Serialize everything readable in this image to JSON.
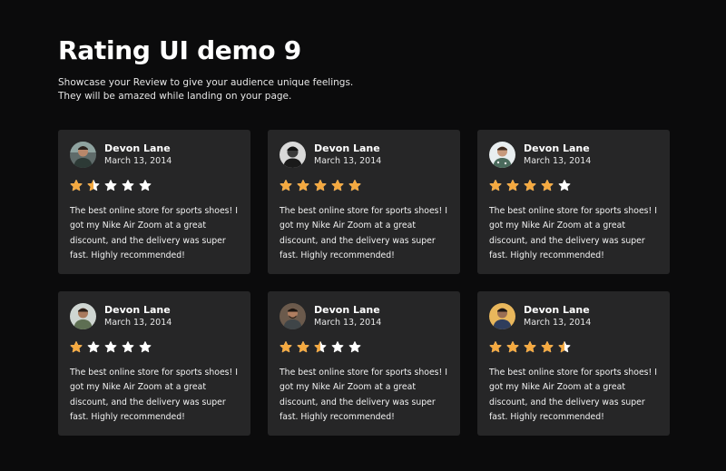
{
  "header": {
    "title": "Rating UI demo 9",
    "subtitle": "Showcase your Review to give your audience unique feelings. They will be amazed while landing on your page."
  },
  "colors": {
    "background": "#0b0b0c",
    "card": "#262627",
    "star_filled": "#f4a940",
    "star_empty": "#ffffff"
  },
  "reviews": [
    {
      "name": "Devon Lane",
      "date": "March 13, 2014",
      "rating": 1.5,
      "avatar": "avatar-photo",
      "text": "The best online store for sports shoes! I got my Nike Air Zoom at a great discount, and the delivery was super fast. Highly recommended!"
    },
    {
      "name": "Devon Lane",
      "date": "March 13, 2014",
      "rating": 5,
      "avatar": "avatar-photo",
      "text": "The best online store for sports shoes! I got my Nike Air Zoom at a great discount, and the delivery was super fast. Highly recommended!"
    },
    {
      "name": "Devon Lane",
      "date": "March 13, 2014",
      "rating": 4,
      "avatar": "avatar-photo",
      "text": "The best online store for sports shoes! I got my Nike Air Zoom at a great discount, and the delivery was super fast. Highly recommended!"
    },
    {
      "name": "Devon Lane",
      "date": "March 13, 2014",
      "rating": 1,
      "avatar": "avatar-photo",
      "text": "The best online store for sports shoes! I got my Nike Air Zoom at a great discount, and the delivery was super fast. Highly recommended!"
    },
    {
      "name": "Devon Lane",
      "date": "March 13, 2014",
      "rating": 2.5,
      "avatar": "avatar-photo",
      "text": "The best online store for sports shoes! I got my Nike Air Zoom at a great discount, and the delivery was super fast. Highly recommended!"
    },
    {
      "name": "Devon Lane",
      "date": "March 13, 2014",
      "rating": 4.5,
      "avatar": "avatar-photo",
      "text": "The best online store for sports shoes! I got my Nike Air Zoom at a great discount, and the delivery was super fast. Highly recommended!"
    }
  ]
}
